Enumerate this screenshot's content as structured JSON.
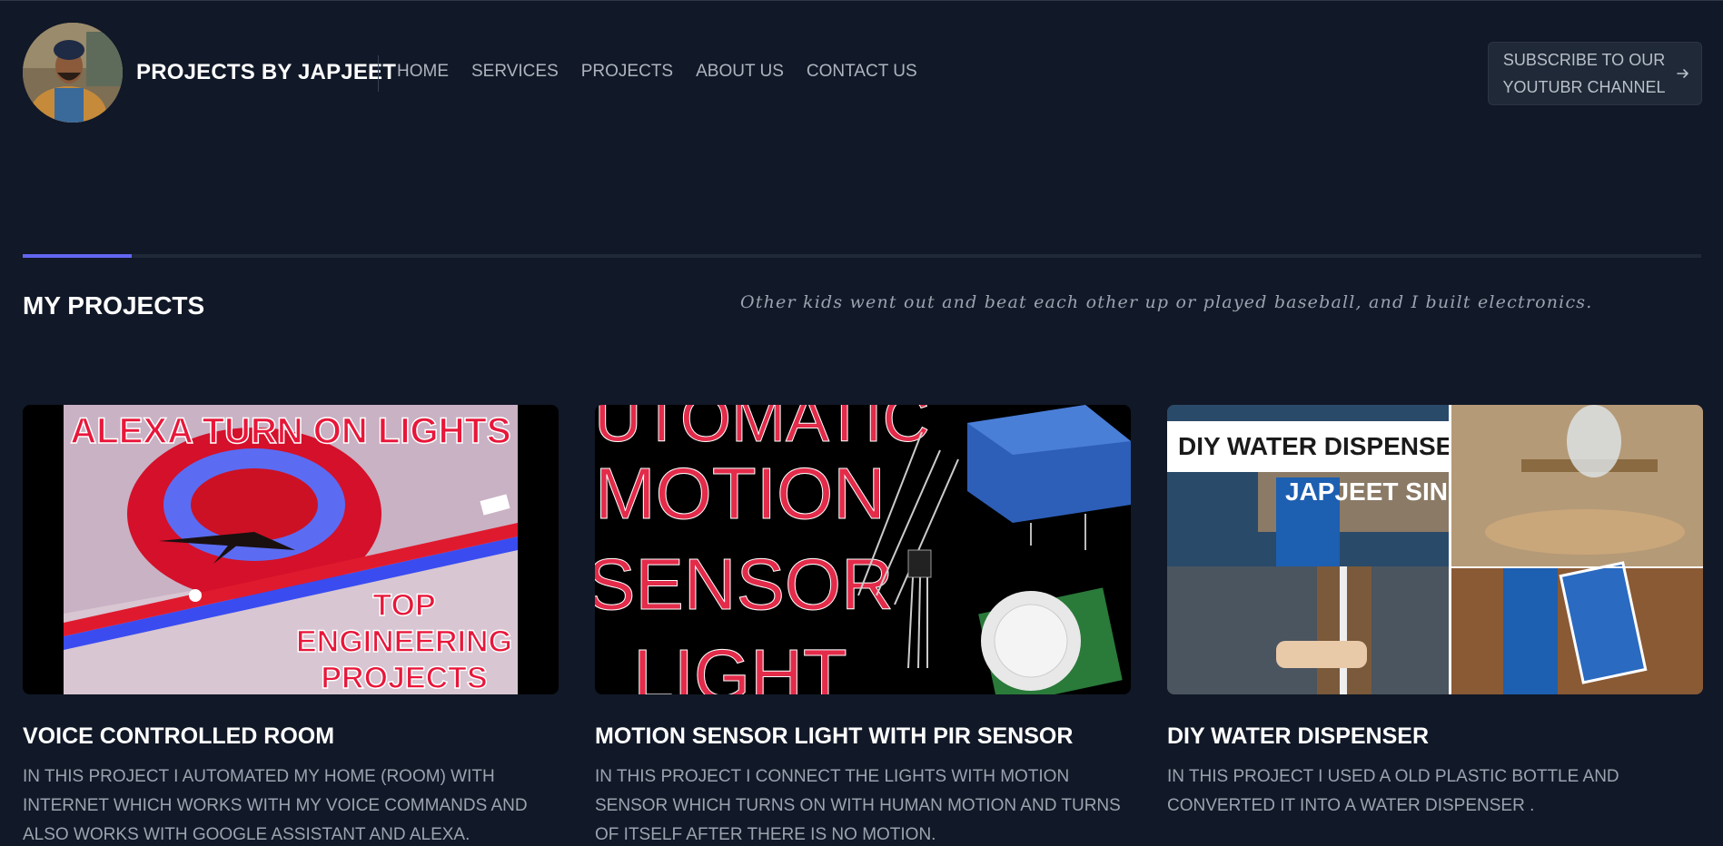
{
  "header": {
    "brand": "PROJECTS BY JAPJEET",
    "nav": [
      {
        "label": "HOME"
      },
      {
        "label": "SERVICES"
      },
      {
        "label": "PROJECTS"
      },
      {
        "label": "ABOUT US"
      },
      {
        "label": "CONTACT US"
      }
    ],
    "subscribe_label": "SUBSCRIBE TO OUR YOUTUBR CHANNEL",
    "subscribe_icon": "arrow-right-icon"
  },
  "section": {
    "title": "MY PROJECTS",
    "quote": "Other kids went out and beat each other up or played baseball, and I built electronics."
  },
  "projects": [
    {
      "title": "VOICE CONTROLLED ROOM",
      "description": "IN THIS PROJECT I AUTOMATED MY HOME (ROOM) WITH INTERNET WHICH WORKS WITH MY VOICE COMMANDS AND ALSO WORKS WITH GOOGLE ASSISTANT AND ALEXA.",
      "thumb": {
        "line1": "ALEXA TURN ON LIGHTS",
        "line2": "TOP",
        "line3": "ENGINEERING",
        "line4": "PROJECTS"
      }
    },
    {
      "title": "MOTION SENSOR LIGHT WITH PIR SENSOR",
      "description": "IN THIS PROJECT I CONNECT THE LIGHTS WITH MOTION SENSOR WHICH TURNS ON WITH HUMAN MOTION AND TURNS OF ITSELF AFTER THERE IS NO MOTION.",
      "thumb": {
        "line1": "AUTOMATIC",
        "line2": "MOTION",
        "line3": "SENSOR",
        "line4": "LIGHT"
      }
    },
    {
      "title": "DIY WATER DISPENSER",
      "description": "IN THIS PROJECT I USED A OLD PLASTIC BOTTLE AND CONVERTED IT INTO A WATER DISPENSER .",
      "thumb": {
        "line1": "DIY WATER DISPENSER",
        "line2": "JAPJEET SINGH"
      }
    }
  ],
  "colors": {
    "background": "#111827",
    "accent": "#6366f1",
    "button_bg": "#1f2937"
  }
}
